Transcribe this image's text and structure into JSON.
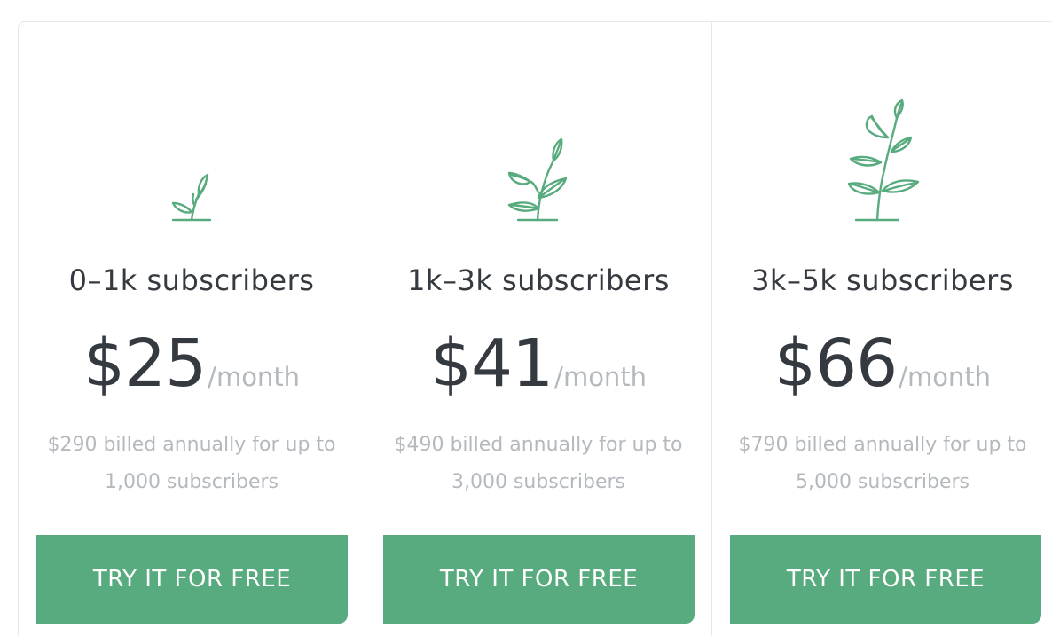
{
  "accent_color": "#58ab7e",
  "plans": [
    {
      "icon": "small-sprout-icon",
      "tier": "0–1k subscribers",
      "amount": "$25",
      "unit": "/month",
      "billing_line1": "$290 billed annually for up to",
      "billing_line2": "1,000 subscribers",
      "cta": "TRY IT FOR FREE"
    },
    {
      "icon": "medium-plant-icon",
      "tier": "1k–3k subscribers",
      "amount": "$41",
      "unit": "/month",
      "billing_line1": "$490 billed annually for up to",
      "billing_line2": "3,000 subscribers",
      "cta": "TRY IT FOR FREE"
    },
    {
      "icon": "large-plant-icon",
      "tier": "3k–5k subscribers",
      "amount": "$66",
      "unit": "/month",
      "billing_line1": "$790 billed annually for up to",
      "billing_line2": "5,000 subscribers",
      "cta": "TRY IT FOR FREE"
    }
  ]
}
